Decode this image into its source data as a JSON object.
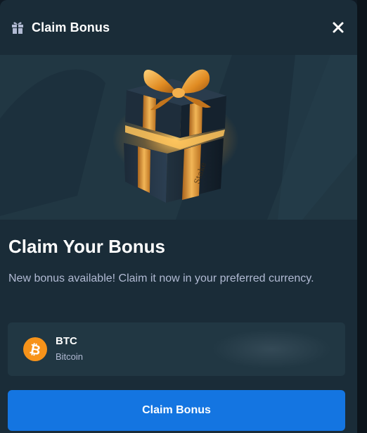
{
  "header": {
    "title": "Claim Bonus",
    "gift_icon": "gift-icon",
    "close_icon": "close-icon"
  },
  "banner": {
    "image": "gift-box-illustration",
    "box_print": "Stake"
  },
  "main": {
    "heading": "Claim Your Bonus",
    "description": "New bonus available! Claim it now in your preferred currency."
  },
  "currency": {
    "code": "BTC",
    "name": "Bitcoin",
    "icon": "bitcoin-icon",
    "icon_color": "#f7931a"
  },
  "actions": {
    "claim_label": "Claim Bonus"
  },
  "colors": {
    "background": "#1a2c38",
    "card": "#213743",
    "primary_button": "#1475e1",
    "text_secondary": "#b1bad3"
  }
}
